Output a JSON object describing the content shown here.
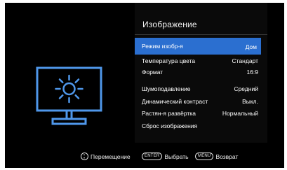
{
  "menu": {
    "title": "Изображение",
    "items": [
      {
        "label": "Режим изобр-я",
        "value": "Дом"
      },
      {
        "label": "Температура цвета",
        "value": "Стандарт"
      },
      {
        "label": "Формат",
        "value": "16:9"
      },
      {
        "label": "Шумоподавление",
        "value": "Средний"
      },
      {
        "label": "Динамический контраст",
        "value": "Выкл."
      },
      {
        "label": "Растян-я развёртка",
        "value": "Нормальный"
      },
      {
        "label": "Сброс изображения",
        "value": ""
      }
    ],
    "selected_index": 0
  },
  "icons": {
    "picture": "monitor-brightness-icon",
    "navigate": "navigate-updown-icon"
  },
  "footer": {
    "navigate_label": "Перемещение",
    "enter_key": "ENTER",
    "select_label": "Выбрать",
    "menu_key": "MENU",
    "back_label": "Возврат"
  },
  "colors": {
    "highlight": "#2b6fd0",
    "icon_stroke": "#4f97ea",
    "background": "#000000"
  }
}
